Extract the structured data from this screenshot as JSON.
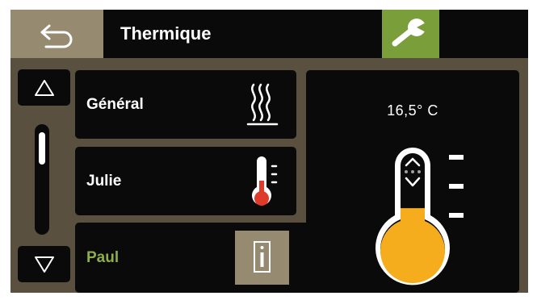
{
  "header": {
    "title": "Thermique"
  },
  "list": {
    "items": [
      {
        "label": "Général",
        "icon": "heat-waves-icon",
        "selected": false
      },
      {
        "label": "Julie",
        "icon": "thermometer-low-icon",
        "selected": false
      },
      {
        "label": "Paul",
        "icon": "info-icon",
        "selected": true
      }
    ]
  },
  "detail": {
    "temperature": "16,5° C",
    "fill_level": 0.55
  },
  "colors": {
    "accent_green": "#7a9e3a",
    "selected_text": "#8fae48",
    "back_button": "#968a70",
    "thermo_fill": "#f5ad1e",
    "low_red": "#e03a2a"
  }
}
